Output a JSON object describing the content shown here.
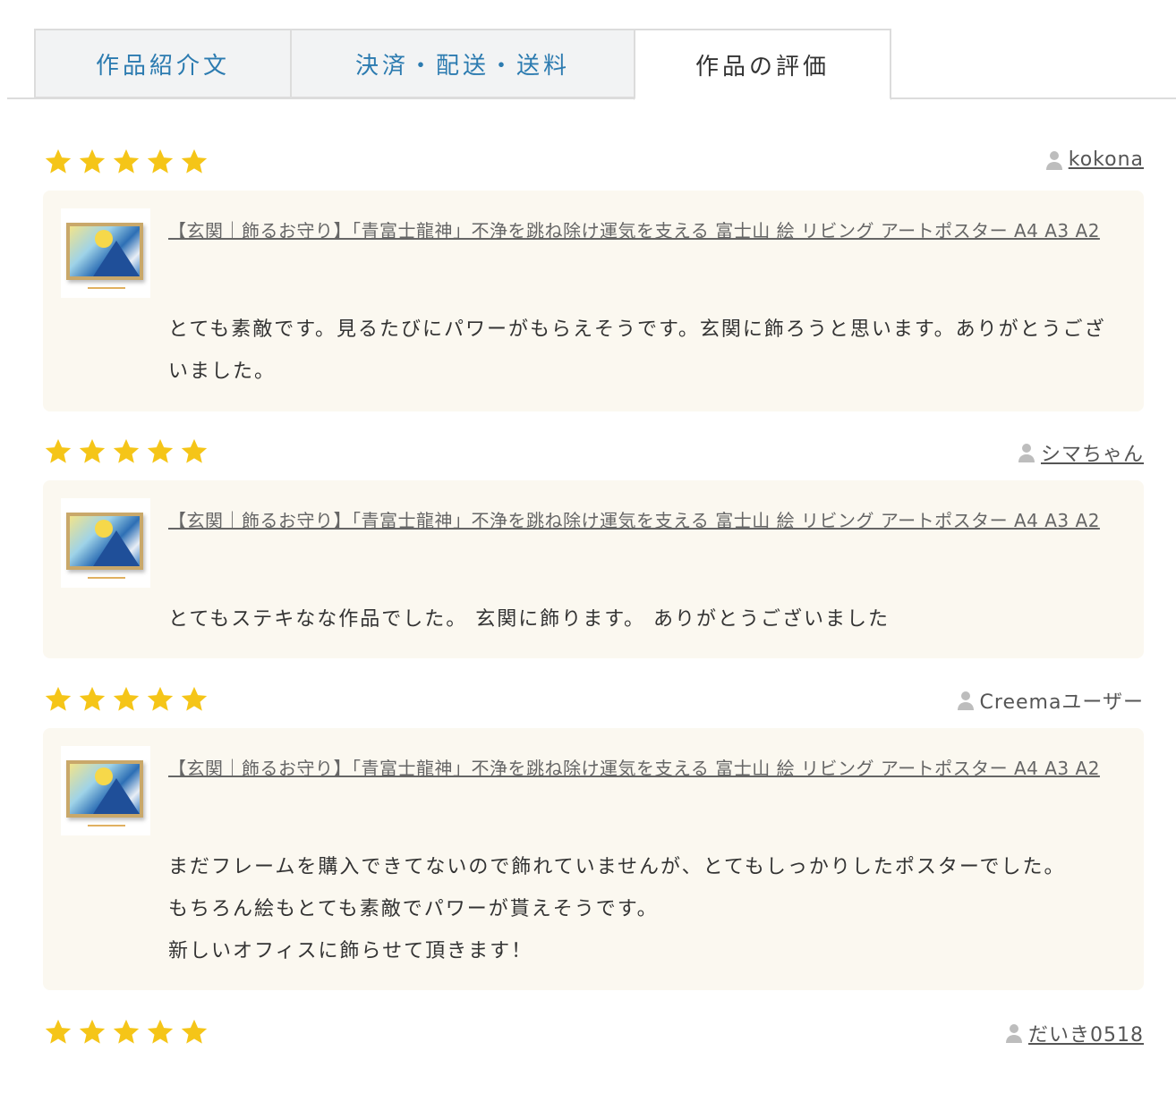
{
  "tabs": {
    "description": "作品紹介文",
    "payment": "決済・配送・送料",
    "reviews": "作品の評価"
  },
  "reviews": [
    {
      "stars": 5,
      "reviewer": "kokona",
      "reviewer_linked": true,
      "product_title": "【玄関｜飾るお守り】「青富士龍神」不浄を跳ね除け運気を支える 富士山 絵 リビング アートポスター A4 A3 A2",
      "comment": [
        "とても素敵です。見るたびにパワーがもらえそうです。玄関に飾ろうと思います。ありがとうございました。"
      ]
    },
    {
      "stars": 5,
      "reviewer": "シマちゃん",
      "reviewer_linked": true,
      "product_title": "【玄関｜飾るお守り】「青富士龍神」不浄を跳ね除け運気を支える 富士山 絵 リビング アートポスター A4 A3 A2",
      "comment": [
        "とてもステキなな作品でした。 玄関に飾ります。 ありがとうございました"
      ]
    },
    {
      "stars": 5,
      "reviewer": "Creemaユーザー",
      "reviewer_linked": false,
      "product_title": "【玄関｜飾るお守り】「青富士龍神」不浄を跳ね除け運気を支える 富士山 絵 リビング アートポスター A4 A3 A2",
      "comment": [
        "まだフレームを購入できてないので飾れていませんが、とてもしっかりしたポスターでした。",
        "もちろん絵もとても素敵でパワーが貰えそうです。",
        "新しいオフィスに飾らせて頂きます！"
      ]
    },
    {
      "stars": 5,
      "reviewer": "だいき0518",
      "reviewer_linked": true
    }
  ],
  "colors": {
    "star": "#f5c518",
    "tab_link": "#2c7bb0",
    "card_bg": "#fbf8f0"
  }
}
